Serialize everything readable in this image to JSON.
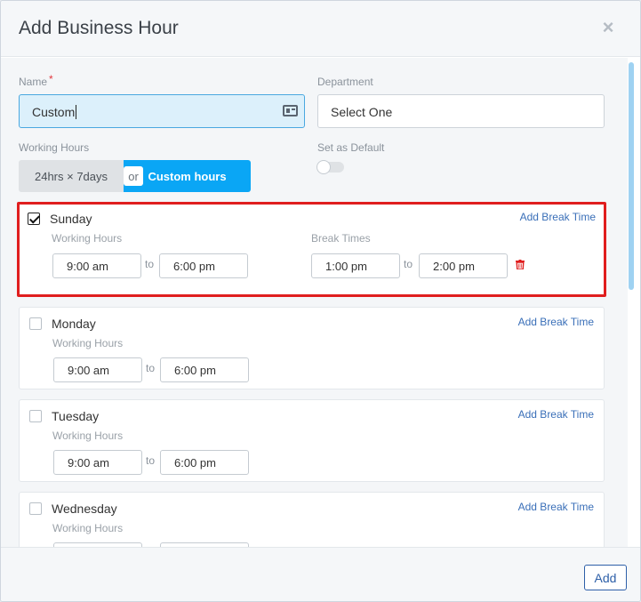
{
  "modal": {
    "title": "Add Business Hour",
    "close_label": "×"
  },
  "form": {
    "name_label": "Name",
    "name_required_mark": "*",
    "name_value": "Custom",
    "department_label": "Department",
    "department_value": "Select One",
    "working_hours_label": "Working Hours",
    "hours_options": {
      "all_days": "24hrs × 7days",
      "or": "or",
      "custom": "Custom hours",
      "selected": "Custom hours"
    },
    "default_label": "Set as Default",
    "default_on": false
  },
  "days": [
    {
      "name": "Sunday",
      "checked": true,
      "add_break_label": "Add Break Time",
      "working_hours_label": "Working Hours",
      "from": "9:00 am",
      "to_label": "to",
      "to": "6:00 pm",
      "break_label": "Break Times",
      "break_from": "1:00 pm",
      "break_to_label": "to",
      "break_to": "2:00 pm"
    },
    {
      "name": "Monday",
      "checked": false,
      "add_break_label": "Add Break Time",
      "working_hours_label": "Working Hours",
      "from": "9:00 am",
      "to_label": "to",
      "to": "6:00 pm"
    },
    {
      "name": "Tuesday",
      "checked": false,
      "add_break_label": "Add Break Time",
      "working_hours_label": "Working Hours",
      "from": "9:00 am",
      "to_label": "to",
      "to": "6:00 pm"
    },
    {
      "name": "Wednesday",
      "checked": false,
      "add_break_label": "Add Break Time",
      "working_hours_label": "Working Hours"
    }
  ],
  "footer": {
    "add_label": "Add"
  },
  "colors": {
    "accent": "#0aa6f5",
    "highlight": "#e01e1e",
    "link": "#3a6fb8",
    "delete": "#e01e1e"
  }
}
